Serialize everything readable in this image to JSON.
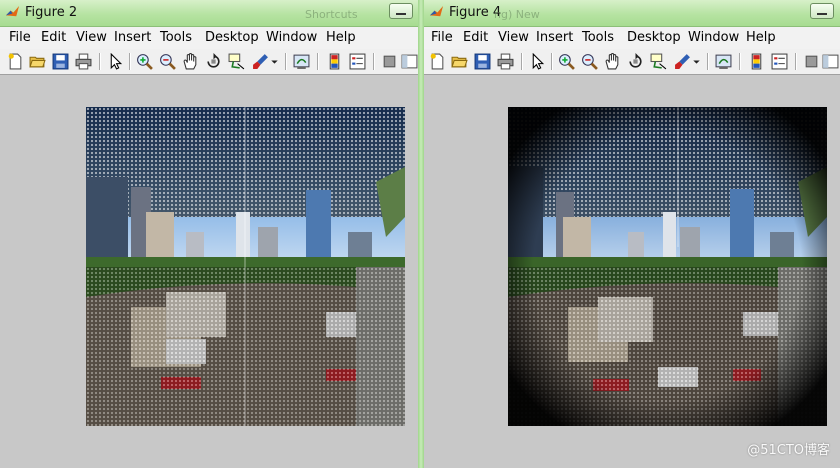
{
  "windows": [
    {
      "title": "Figure 2",
      "ghost_title": "Shortcuts",
      "menu": [
        "File",
        "Edit",
        "View",
        "Insert",
        "Tools",
        "Desktop",
        "Window",
        "Help"
      ]
    },
    {
      "title": "Figure 4",
      "ghost_title": "ng) New",
      "menu": [
        "File",
        "Edit",
        "View",
        "Insert",
        "Tools",
        "Desktop",
        "Window",
        "Help"
      ]
    }
  ],
  "toolbar_icons": [
    "new-figure-icon",
    "open-file-icon",
    "save-icon",
    "print-icon",
    "pointer-icon",
    "zoom-in-icon",
    "zoom-out-icon",
    "pan-icon",
    "rotate-3d-icon",
    "data-cursor-icon",
    "brush-icon",
    "link-plot-icon",
    "colorbar-icon",
    "legend-icon",
    "hide-plot-tools-icon",
    "show-plot-tools-icon"
  ],
  "colors": {
    "titlebar": "#b6e3a2",
    "toolbar": "#f0f0f0",
    "figure_bg": "#c8c8c8",
    "sky": "#4f86c8"
  },
  "watermark": "@51CTO博客"
}
